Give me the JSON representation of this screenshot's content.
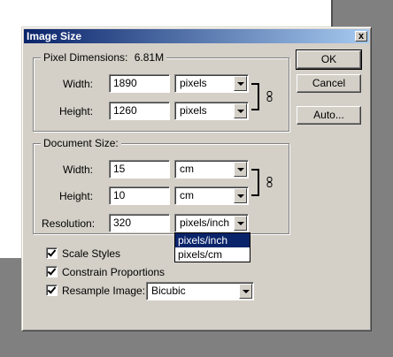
{
  "dialog": {
    "title": "Image Size",
    "close_glyph": "x"
  },
  "pixel_dimensions": {
    "label": "Pixel Dimensions:",
    "size": "6.81M",
    "width_label": "Width:",
    "width_value": "1890",
    "width_unit": "pixels",
    "height_label": "Height:",
    "height_value": "1260",
    "height_unit": "pixels"
  },
  "document_size": {
    "label": "Document Size:",
    "width_label": "Width:",
    "width_value": "15",
    "width_unit": "cm",
    "height_label": "Height:",
    "height_value": "10",
    "height_unit": "cm",
    "resolution_label": "Resolution:",
    "resolution_value": "320",
    "resolution_unit": "pixels/inch"
  },
  "resolution_dropdown": {
    "options": [
      "pixels/inch",
      "pixels/cm"
    ],
    "selected": "pixels/inch"
  },
  "buttons": {
    "ok": "OK",
    "cancel": "Cancel",
    "auto": "Auto..."
  },
  "options": {
    "scale_styles": {
      "label": "Scale Styles",
      "checked": true
    },
    "constrain_proportions": {
      "label": "Constrain Proportions",
      "checked": true
    },
    "resample_image": {
      "label": "Resample Image:",
      "checked": true,
      "method": "Bicubic"
    }
  },
  "icons": {
    "chain_link": "chain-link-icon",
    "dropdown_arrow": "chevron-down-icon"
  }
}
